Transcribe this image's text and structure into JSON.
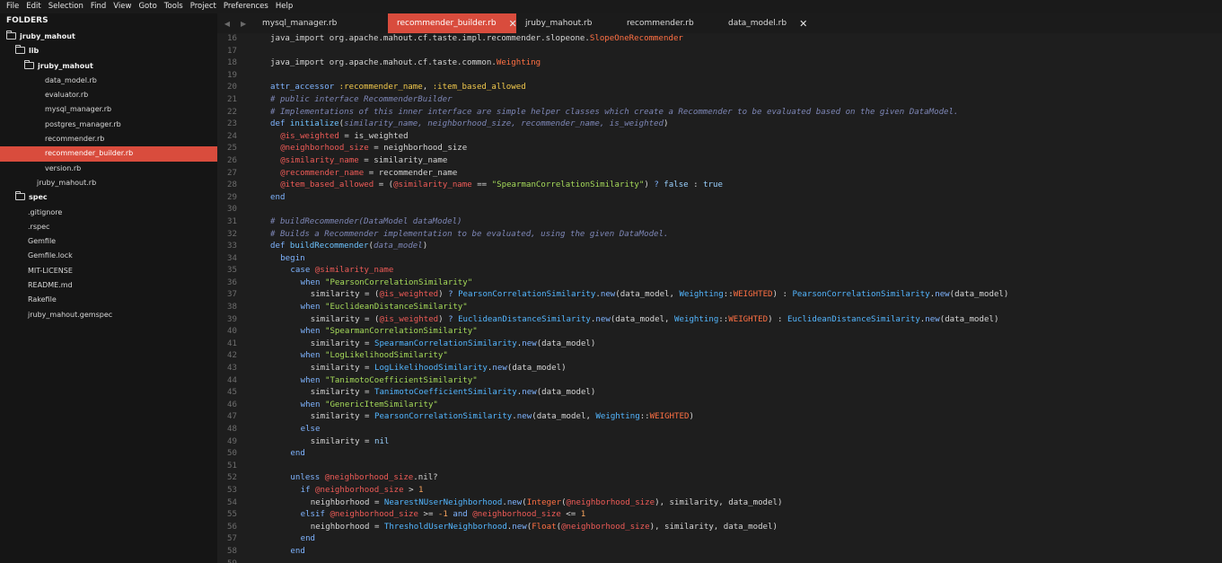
{
  "menu": [
    "File",
    "Edit",
    "Selection",
    "Find",
    "View",
    "Goto",
    "Tools",
    "Project",
    "Preferences",
    "Help"
  ],
  "sidebar": {
    "header": "FOLDERS",
    "tree": [
      {
        "label": "jruby_mahout",
        "folder": true,
        "depth": 0
      },
      {
        "label": "lib",
        "folder": true,
        "depth": 1
      },
      {
        "label": "jruby_mahout",
        "folder": true,
        "depth": 2
      },
      {
        "label": "data_model.rb",
        "folder": false,
        "depth": 3
      },
      {
        "label": "evaluator.rb",
        "folder": false,
        "depth": 3
      },
      {
        "label": "mysql_manager.rb",
        "folder": false,
        "depth": 3
      },
      {
        "label": "postgres_manager.rb",
        "folder": false,
        "depth": 3
      },
      {
        "label": "recommender.rb",
        "folder": false,
        "depth": 3
      },
      {
        "label": "recommender_builder.rb",
        "folder": false,
        "depth": 3,
        "selected": true
      },
      {
        "label": "version.rb",
        "folder": false,
        "depth": 3
      },
      {
        "label": "jruby_mahout.rb",
        "folder": false,
        "depth": 2
      },
      {
        "label": "spec",
        "folder": true,
        "depth": 1
      },
      {
        "label": ".gitignore",
        "folder": false,
        "depth": 1
      },
      {
        "label": ".rspec",
        "folder": false,
        "depth": 1
      },
      {
        "label": "Gemfile",
        "folder": false,
        "depth": 1
      },
      {
        "label": "Gemfile.lock",
        "folder": false,
        "depth": 1
      },
      {
        "label": "MIT-LICENSE",
        "folder": false,
        "depth": 1
      },
      {
        "label": "README.md",
        "folder": false,
        "depth": 1
      },
      {
        "label": "Rakefile",
        "folder": false,
        "depth": 1
      },
      {
        "label": "jruby_mahout.gemspec",
        "folder": false,
        "depth": 1
      }
    ]
  },
  "tabs": [
    {
      "label": "mysql_manager.rb",
      "active": false,
      "close": ""
    },
    {
      "label": "recommender_builder.rb",
      "active": true,
      "close": "✕"
    },
    {
      "label": "jruby_mahout.rb",
      "active": false,
      "close": ""
    },
    {
      "label": "recommender.rb",
      "active": false,
      "close": ""
    },
    {
      "label": "data_model.rb",
      "active": false,
      "close": "✕"
    }
  ],
  "colors": {
    "accent": "#d94c3d",
    "sidebar_bg": "#151515",
    "editor_bg": "#1e1e1e"
  },
  "code": {
    "lines": [
      {
        "n": "16",
        "ind": 0,
        "t": [
          [
            "plain",
            "java_import org.apache.mahout.cf.taste.impl.recommender.slopeone."
          ],
          [
            "const",
            "SlopeOneRecommender"
          ]
        ]
      },
      {
        "n": "17",
        "ind": 0,
        "t": []
      },
      {
        "n": "18",
        "ind": 0,
        "t": [
          [
            "plain",
            "java_import org.apache.mahout.cf.taste.common."
          ],
          [
            "const",
            "Weighting"
          ]
        ]
      },
      {
        "n": "19",
        "ind": 0,
        "t": []
      },
      {
        "n": "20",
        "ind": 0,
        "t": [
          [
            "kw",
            "attr_accessor "
          ],
          [
            "sym",
            ":recommender_name"
          ],
          [
            "plain",
            ", "
          ],
          [
            "sym",
            ":item_based_allowed"
          ]
        ]
      },
      {
        "n": "21",
        "ind": 0,
        "t": [
          [
            "cmt",
            "# public interface RecommenderBuilder"
          ]
        ]
      },
      {
        "n": "22",
        "ind": 0,
        "t": [
          [
            "cmt",
            "# Implementations of this inner interface are simple helper classes which create a Recommender to be evaluated based on the given DataModel."
          ]
        ]
      },
      {
        "n": "23",
        "ind": 0,
        "t": [
          [
            "kw",
            "def "
          ],
          [
            "fn",
            "initialize"
          ],
          [
            "plain",
            "("
          ],
          [
            "cmt",
            "similarity_name, neighborhood_size, recommender_name, is_weighted"
          ],
          [
            "plain",
            ")"
          ]
        ]
      },
      {
        "n": "24",
        "ind": 1,
        "t": [
          [
            "ivar",
            "@is_weighted"
          ],
          [
            "plain",
            " = is_weighted"
          ]
        ]
      },
      {
        "n": "25",
        "ind": 1,
        "t": [
          [
            "ivar",
            "@neighborhood_size"
          ],
          [
            "plain",
            " = neighborhood_size"
          ]
        ]
      },
      {
        "n": "26",
        "ind": 1,
        "t": [
          [
            "ivar",
            "@similarity_name"
          ],
          [
            "plain",
            " = similarity_name"
          ]
        ]
      },
      {
        "n": "27",
        "ind": 1,
        "t": [
          [
            "ivar",
            "@recommender_name"
          ],
          [
            "plain",
            " = recommender_name"
          ]
        ]
      },
      {
        "n": "28",
        "ind": 1,
        "t": [
          [
            "ivar",
            "@item_based_allowed"
          ],
          [
            "plain",
            " = ("
          ],
          [
            "ivar",
            "@similarity_name"
          ],
          [
            "plain",
            " == "
          ],
          [
            "str",
            "\"SpearmanCorrelationSimilarity\""
          ],
          [
            "plain",
            ") "
          ],
          [
            "kw",
            "?"
          ],
          [
            "bool",
            " false"
          ],
          [
            "plain",
            " : "
          ],
          [
            "bool",
            "true"
          ]
        ]
      },
      {
        "n": "29",
        "ind": 0,
        "t": [
          [
            "kw",
            "end"
          ]
        ]
      },
      {
        "n": "30",
        "ind": 0,
        "t": []
      },
      {
        "n": "31",
        "ind": 0,
        "t": [
          [
            "cmt",
            "# buildRecommender(DataModel dataModel)"
          ]
        ]
      },
      {
        "n": "32",
        "ind": 0,
        "t": [
          [
            "cmt",
            "# Builds a Recommender implementation to be evaluated, using the given DataModel."
          ]
        ]
      },
      {
        "n": "33",
        "ind": 0,
        "t": [
          [
            "kw",
            "def "
          ],
          [
            "fn",
            "buildRecommender"
          ],
          [
            "plain",
            "("
          ],
          [
            "cmt",
            "data_model"
          ],
          [
            "plain",
            ")"
          ]
        ]
      },
      {
        "n": "34",
        "ind": 1,
        "t": [
          [
            "kw",
            "begin"
          ]
        ]
      },
      {
        "n": "35",
        "ind": 2,
        "t": [
          [
            "kw",
            "case "
          ],
          [
            "ivar",
            "@similarity_name"
          ]
        ]
      },
      {
        "n": "36",
        "ind": 3,
        "t": [
          [
            "kw",
            "when "
          ],
          [
            "str",
            "\"PearsonCorrelationSimilarity\""
          ]
        ]
      },
      {
        "n": "37",
        "ind": 4,
        "t": [
          [
            "plain",
            "similarity = ("
          ],
          [
            "ivar",
            "@is_weighted"
          ],
          [
            "plain",
            ") "
          ],
          [
            "kw",
            "?"
          ],
          [
            "cls",
            " PearsonCorrelationSimilarity"
          ],
          [
            "plain",
            "."
          ],
          [
            "kw",
            "new"
          ],
          [
            "plain",
            "(data_model, "
          ],
          [
            "cls",
            "Weighting"
          ],
          [
            "plain",
            "::"
          ],
          [
            "const",
            "WEIGHTED"
          ],
          [
            "plain",
            ") : "
          ],
          [
            "cls",
            "PearsonCorrelationSimilarity"
          ],
          [
            "plain",
            "."
          ],
          [
            "kw",
            "new"
          ],
          [
            "plain",
            "(data_model)"
          ]
        ]
      },
      {
        "n": "38",
        "ind": 3,
        "t": [
          [
            "kw",
            "when "
          ],
          [
            "str",
            "\"EuclideanDistanceSimilarity\""
          ]
        ]
      },
      {
        "n": "39",
        "ind": 4,
        "t": [
          [
            "plain",
            "similarity = ("
          ],
          [
            "ivar",
            "@is_weighted"
          ],
          [
            "plain",
            ") "
          ],
          [
            "kw",
            "?"
          ],
          [
            "cls",
            " EuclideanDistanceSimilarity"
          ],
          [
            "plain",
            "."
          ],
          [
            "kw",
            "new"
          ],
          [
            "plain",
            "(data_model, "
          ],
          [
            "cls",
            "Weighting"
          ],
          [
            "plain",
            "::"
          ],
          [
            "const",
            "WEIGHTED"
          ],
          [
            "plain",
            ") : "
          ],
          [
            "cls",
            "EuclideanDistanceSimilarity"
          ],
          [
            "plain",
            "."
          ],
          [
            "kw",
            "new"
          ],
          [
            "plain",
            "(data_model)"
          ]
        ]
      },
      {
        "n": "40",
        "ind": 3,
        "t": [
          [
            "kw",
            "when "
          ],
          [
            "str",
            "\"SpearmanCorrelationSimilarity\""
          ]
        ]
      },
      {
        "n": "41",
        "ind": 4,
        "t": [
          [
            "plain",
            "similarity = "
          ],
          [
            "cls",
            "SpearmanCorrelationSimilarity"
          ],
          [
            "plain",
            "."
          ],
          [
            "kw",
            "new"
          ],
          [
            "plain",
            "(data_model)"
          ]
        ]
      },
      {
        "n": "42",
        "ind": 3,
        "t": [
          [
            "kw",
            "when "
          ],
          [
            "str",
            "\"LogLikelihoodSimilarity\""
          ]
        ]
      },
      {
        "n": "43",
        "ind": 4,
        "t": [
          [
            "plain",
            "similarity = "
          ],
          [
            "cls",
            "LogLikelihoodSimilarity"
          ],
          [
            "plain",
            "."
          ],
          [
            "kw",
            "new"
          ],
          [
            "plain",
            "(data_model)"
          ]
        ]
      },
      {
        "n": "44",
        "ind": 3,
        "t": [
          [
            "kw",
            "when "
          ],
          [
            "str",
            "\"TanimotoCoefficientSimilarity\""
          ]
        ]
      },
      {
        "n": "45",
        "ind": 4,
        "t": [
          [
            "plain",
            "similarity = "
          ],
          [
            "cls",
            "TanimotoCoefficientSimilarity"
          ],
          [
            "plain",
            "."
          ],
          [
            "kw",
            "new"
          ],
          [
            "plain",
            "(data_model)"
          ]
        ]
      },
      {
        "n": "46",
        "ind": 3,
        "t": [
          [
            "kw",
            "when "
          ],
          [
            "str",
            "\"GenericItemSimilarity\""
          ]
        ]
      },
      {
        "n": "47",
        "ind": 4,
        "t": [
          [
            "plain",
            "similarity = "
          ],
          [
            "cls",
            "PearsonCorrelationSimilarity"
          ],
          [
            "plain",
            "."
          ],
          [
            "kw",
            "new"
          ],
          [
            "plain",
            "(data_model, "
          ],
          [
            "cls",
            "Weighting"
          ],
          [
            "plain",
            "::"
          ],
          [
            "const",
            "WEIGHTED"
          ],
          [
            "plain",
            ")"
          ]
        ]
      },
      {
        "n": "48",
        "ind": 3,
        "t": [
          [
            "kw",
            "else"
          ]
        ]
      },
      {
        "n": "49",
        "ind": 4,
        "t": [
          [
            "plain",
            "similarity = "
          ],
          [
            "bool",
            "nil"
          ]
        ]
      },
      {
        "n": "50",
        "ind": 2,
        "t": [
          [
            "kw",
            "end"
          ]
        ]
      },
      {
        "n": "51",
        "ind": 0,
        "t": []
      },
      {
        "n": "52",
        "ind": 2,
        "t": [
          [
            "kw",
            "unless "
          ],
          [
            "ivar",
            "@neighborhood_size"
          ],
          [
            "plain",
            ".nil?"
          ]
        ]
      },
      {
        "n": "53",
        "ind": 3,
        "t": [
          [
            "kw",
            "if "
          ],
          [
            "ivar",
            "@neighborhood_size"
          ],
          [
            "plain",
            " > "
          ],
          [
            "num",
            "1"
          ]
        ]
      },
      {
        "n": "54",
        "ind": 4,
        "t": [
          [
            "plain",
            "neighborhood = "
          ],
          [
            "cls",
            "NearestNUserNeighborhood"
          ],
          [
            "plain",
            "."
          ],
          [
            "kw",
            "new"
          ],
          [
            "plain",
            "("
          ],
          [
            "const",
            "Integer"
          ],
          [
            "plain",
            "("
          ],
          [
            "ivar",
            "@neighborhood_size"
          ],
          [
            "plain",
            "), similarity, data_model)"
          ]
        ]
      },
      {
        "n": "55",
        "ind": 3,
        "t": [
          [
            "kw",
            "elsif "
          ],
          [
            "ivar",
            "@neighborhood_size"
          ],
          [
            "plain",
            " >= "
          ],
          [
            "num",
            "-1"
          ],
          [
            "kw",
            " and "
          ],
          [
            "ivar",
            "@neighborhood_size"
          ],
          [
            "plain",
            " <= "
          ],
          [
            "num",
            "1"
          ]
        ]
      },
      {
        "n": "56",
        "ind": 4,
        "t": [
          [
            "plain",
            "neighborhood = "
          ],
          [
            "cls",
            "ThresholdUserNeighborhood"
          ],
          [
            "plain",
            "."
          ],
          [
            "kw",
            "new"
          ],
          [
            "plain",
            "("
          ],
          [
            "const",
            "Float"
          ],
          [
            "plain",
            "("
          ],
          [
            "ivar",
            "@neighborhood_size"
          ],
          [
            "plain",
            "), similarity, data_model)"
          ]
        ]
      },
      {
        "n": "57",
        "ind": 3,
        "t": [
          [
            "kw",
            "end"
          ]
        ]
      },
      {
        "n": "58",
        "ind": 2,
        "t": [
          [
            "kw",
            "end"
          ]
        ]
      },
      {
        "n": "59",
        "ind": 0,
        "t": []
      }
    ]
  }
}
